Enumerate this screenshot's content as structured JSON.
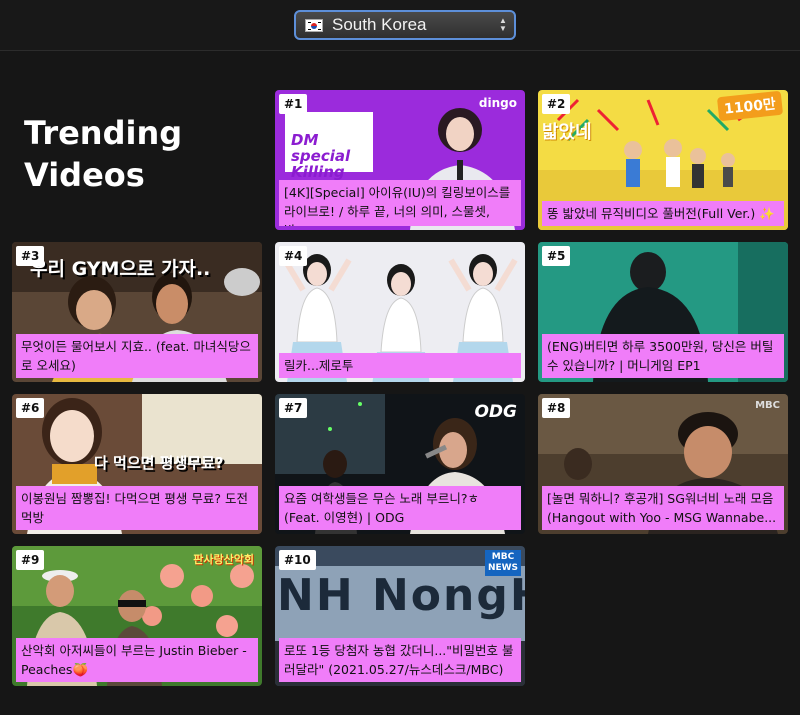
{
  "country_selector": {
    "selected": "South Korea",
    "flag_icon": "south-korea-flag-icon"
  },
  "page_title": "Trending Videos",
  "caption_color": "#f07df9",
  "videos": [
    {
      "rank": "#1",
      "title": "[4K][Special] 아이유(IU)의 킬링보이스를 라이브로! / 하루 끝, 너의 의미, 스물셋, 밤...",
      "thumb_text": "DM special Killing Voice",
      "channel_mark": "dingo"
    },
    {
      "rank": "#2",
      "title": "똥 밟았네 뮤직비디오 풀버전(Full Ver.) ✨",
      "thumb_text": "밟았네",
      "badge": "1100만"
    },
    {
      "rank": "#3",
      "title": "무엇이든 물어보시 지효.. (feat. 마녀식당으로 오세요)",
      "thumb_text": "우리 GYM으로 가자.."
    },
    {
      "rank": "#4",
      "title": "릴카...제로투"
    },
    {
      "rank": "#5",
      "title": "(ENG)버티면 하루 3500만원, 당신은 버틸 수 있습니까? | 머니게임 EP1"
    },
    {
      "rank": "#6",
      "title": "이봉원님 짬뽕집! 다먹으면 평생 무료? 도전먹방",
      "thumb_text": "다 먹으면 평생무료?"
    },
    {
      "rank": "#7",
      "title": "요즘 여학생들은 무슨 노래 부르니?ㅎ (Feat. 이영현) | ODG",
      "channel_mark": "ODG"
    },
    {
      "rank": "#8",
      "title": "[놀면 뭐하니? 후공개] SG워너비 노래 모음 (Hangout with Yoo - MSG Wannabe...",
      "channel_mark": "MBC"
    },
    {
      "rank": "#9",
      "title": "산악회 아저씨들이 부르는 Justin Bieber - Peaches🍑",
      "thumb_text": "판사랑산악회"
    },
    {
      "rank": "#10",
      "title": "로또 1등 당첨자 농협 갔더니...\"비밀번호 불러달라\" (2021.05.27/뉴스데스크/MBC)",
      "thumb_text": "NH NongHyup",
      "channel_mark": "MBC NEWS"
    }
  ]
}
